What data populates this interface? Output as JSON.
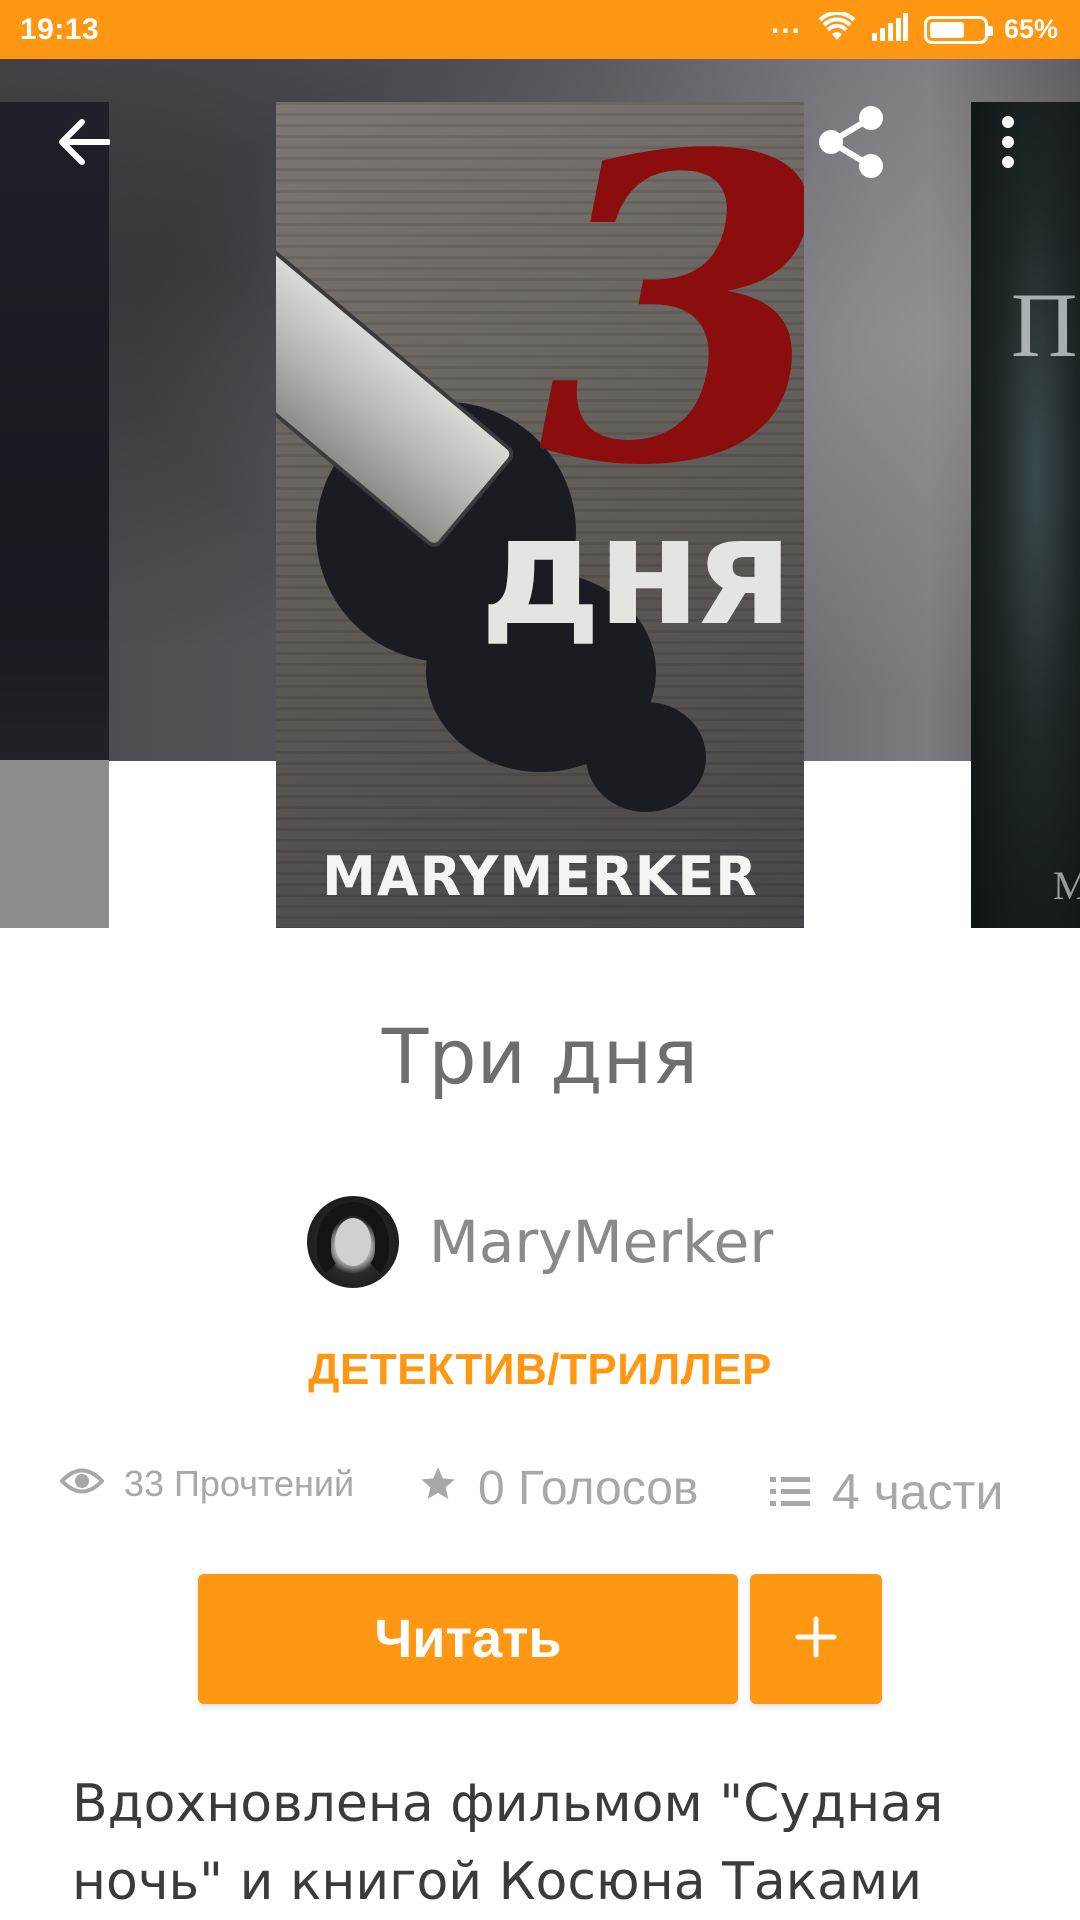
{
  "status_bar": {
    "time": "19:13",
    "dots": "...",
    "battery_percent": "65%",
    "battery_level": 0.65
  },
  "icons": {
    "back": "back-arrow-icon",
    "share": "share-icon",
    "more": "more-vert-icon",
    "reads": "eye-icon",
    "votes": "star-icon",
    "parts": "list-icon",
    "add": "plus-icon"
  },
  "cover": {
    "number": "3",
    "word": "дня",
    "author": "MARYMERKER",
    "right_glyph": "П",
    "right_glyph_small": "M"
  },
  "story": {
    "title": "Три дня",
    "author": "MaryMerker",
    "genre": "ДЕТЕКТИВ/ТРИЛЛЕР",
    "reads": "33 Прочтений",
    "votes": "0 Голосов",
    "parts": "4 части",
    "description": "Вдохновлена фильмом \"Судная ночь\" и книгой Косюна Таками"
  },
  "actions": {
    "read_label": "Читать",
    "add_label": "+"
  },
  "colors": {
    "accent": "#ff9712",
    "text_gray": "#8a8a8a",
    "stats_gray": "#a8a8a8"
  }
}
